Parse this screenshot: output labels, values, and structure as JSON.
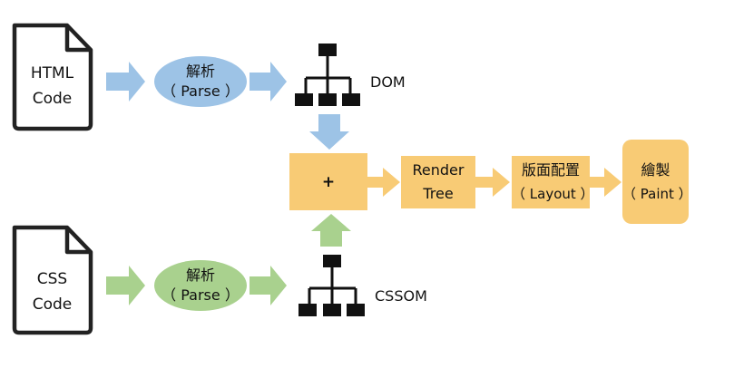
{
  "html_doc": {
    "line1": "HTML",
    "line2": "Code"
  },
  "css_doc": {
    "line1": "CSS",
    "line2": "Code"
  },
  "parse_top": {
    "line1": "解析",
    "line2": "（ Parse ）"
  },
  "parse_bottom": {
    "line1": "解析",
    "line2": "（ Parse ）"
  },
  "dom_label": "DOM",
  "cssom_label": "CSSOM",
  "combine_label": "+",
  "render_tree": {
    "line1": "Render",
    "line2": "Tree"
  },
  "layout": {
    "line1": "版面配置",
    "line2": "（ Layout ）"
  },
  "paint": {
    "line1": "繪製",
    "line2": "（ Paint ）"
  },
  "colors": {
    "blue": "#9dc3e6",
    "green": "#a9d18e",
    "orange": "#f8cb75",
    "black": "#111111"
  }
}
